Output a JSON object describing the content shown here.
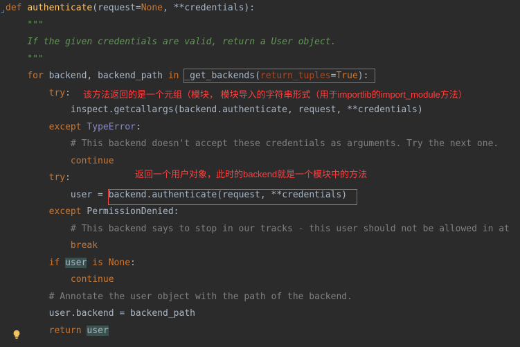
{
  "code": {
    "def": "def",
    "fname": "authenticate",
    "sig_open": "(",
    "p_request": "request",
    "eq": "=",
    "none": "None",
    "comma": ",",
    "star": "**",
    "p_cred": "credentials",
    "sig_close": "):",
    "doc_open": "\"\"\"",
    "doc_line": "If the given credentials are valid, return a User object.",
    "doc_close": "\"\"\"",
    "for": "for",
    "backend": "backend",
    "backend_path": "backend_path",
    "in": "in",
    "get_backends": "_get_backends",
    "return_tuples": "return_tuples",
    "true": "True",
    "try": "try",
    "colon": ":",
    "inspect": "inspect",
    "dot": ".",
    "getcallargs": "getcallargs",
    "auth": "authenticate",
    "request": "request",
    "except": "except",
    "typeerror": "TypeError",
    "c1": "# This backend doesn't accept these credentials as arguments. Try the next one.",
    "continue": "continue",
    "user": "user",
    "assign": " = ",
    "permdenied": "PermissionDenied",
    "c2": "# This backend says to stop in our tracks - this user should not be allowed in at",
    "break": "break",
    "if": "if",
    "is": "is",
    "c3": "# Annotate the user object with the path of the backend.",
    "return": "return"
  },
  "annotations": {
    "a1": "该方法返回的是一个元组（模块， 模块导入的字符串形式（用于importlib的import_module方法）",
    "a2": "返回一个用户对象，此时的backend就是一个模块中的方法"
  }
}
